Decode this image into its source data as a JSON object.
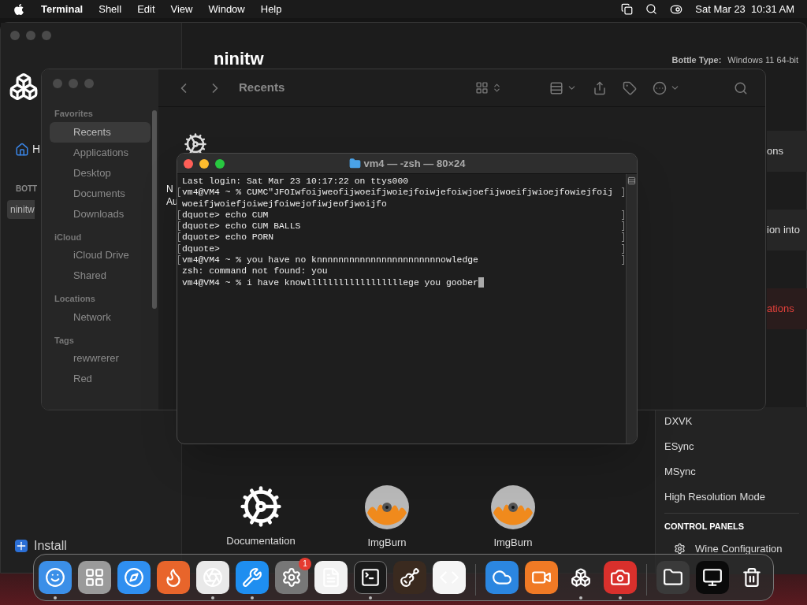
{
  "menu_bar": {
    "app": "Terminal",
    "menus": [
      "Shell",
      "Edit",
      "View",
      "Window",
      "Help"
    ],
    "clock": "Sat Mar 23  10:31 AM"
  },
  "whisky": {
    "home_label": "H",
    "section": "BOTT",
    "bottles": [
      {
        "label": "ninitw",
        "selected": true
      }
    ],
    "install": "Install",
    "title": "ninitw",
    "bottle_type_label": "Bottle Type:",
    "bottle_type": "Windows 11 64-bit",
    "panel_fragments": [
      {
        "text": "ons",
        "kind": "normal"
      },
      {
        "text": "ion into",
        "kind": "normal"
      },
      {
        "text": "ations",
        "kind": "danger"
      }
    ],
    "settings": [
      "DXVK",
      "ESync",
      "MSync",
      "High Resolution Mode"
    ],
    "control_panels_heading": "CONTROL PANELS",
    "control_panels": [
      "Wine Configuration"
    ],
    "programs": [
      {
        "label": "Documentation",
        "kind": "docs"
      },
      {
        "label": "ImgBurn",
        "kind": "disc"
      },
      {
        "label": "ImgBurn",
        "kind": "disc"
      }
    ]
  },
  "finder": {
    "title": "Recents",
    "content_fragments": [
      "N",
      "Au"
    ],
    "sidebar": [
      {
        "heading": "Favorites",
        "items": [
          {
            "label": "Recents",
            "selected": true
          },
          {
            "label": "Applications",
            "selected": false
          },
          {
            "label": "Desktop",
            "selected": false
          },
          {
            "label": "Documents",
            "selected": false
          },
          {
            "label": "Downloads",
            "selected": false
          }
        ]
      },
      {
        "heading": "iCloud",
        "items": [
          {
            "label": "iCloud Drive",
            "selected": false
          },
          {
            "label": "Shared",
            "selected": false
          }
        ]
      },
      {
        "heading": "Locations",
        "items": [
          {
            "label": "Network",
            "selected": false
          }
        ]
      },
      {
        "heading": "Tags",
        "items": [
          {
            "label": "rewwrerer",
            "selected": false
          },
          {
            "label": "Red",
            "selected": false
          }
        ]
      }
    ]
  },
  "terminal": {
    "title": "vm4 — -zsh — 80×24",
    "cursor": true,
    "lines": [
      {
        "text": "Last login: Sat Mar 23 10:17:22 on ttys000",
        "marked": false
      },
      {
        "text": "vm4@VM4 ~ % CUMC\"JFOIwfoijweofijwoeifjwoiejfoiwjefoiwjoefijwoeifjwioejfowiejfoij",
        "marked": true
      },
      {
        "text": "woeifjwoiefjoiwejfoiwejofiwjeofjwoijfo",
        "marked": false
      },
      {
        "text": "dquote> echo CUM",
        "marked": true
      },
      {
        "text": "dquote> echo CUM BALLS",
        "marked": true
      },
      {
        "text": "dquote> echo PORN",
        "marked": true
      },
      {
        "text": "dquote>",
        "marked": true
      },
      {
        "text": "vm4@VM4 ~ % you have no knnnnnnnnnnnnnnnnnnnnnnnowledge",
        "marked": true
      },
      {
        "text": "zsh: command not found: you",
        "marked": false
      },
      {
        "text": "vm4@VM4 ~ % i have knowllllllllllllllllllege you goober",
        "marked": false
      }
    ]
  },
  "dock": {
    "items": [
      {
        "kind": "finder",
        "running": true
      },
      {
        "kind": "launchpad",
        "running": false
      },
      {
        "kind": "safari",
        "running": false
      },
      {
        "kind": "firefox",
        "running": false
      },
      {
        "kind": "chrome",
        "running": true
      },
      {
        "kind": "appstore",
        "running": true
      },
      {
        "kind": "settings",
        "running": false,
        "badge": "1"
      },
      {
        "kind": "textedit",
        "running": false
      },
      {
        "kind": "terminal",
        "running": true
      },
      {
        "kind": "guitar",
        "running": false
      },
      {
        "kind": "code",
        "running": false
      },
      {
        "kind": "separator"
      },
      {
        "kind": "weather",
        "running": false
      },
      {
        "kind": "recorder",
        "running": false
      },
      {
        "kind": "whisky",
        "running": true
      },
      {
        "kind": "photobooth",
        "running": true
      },
      {
        "kind": "separator"
      },
      {
        "kind": "stack",
        "running": false
      },
      {
        "kind": "screenshot",
        "running": false
      },
      {
        "kind": "trash",
        "running": false
      }
    ]
  }
}
